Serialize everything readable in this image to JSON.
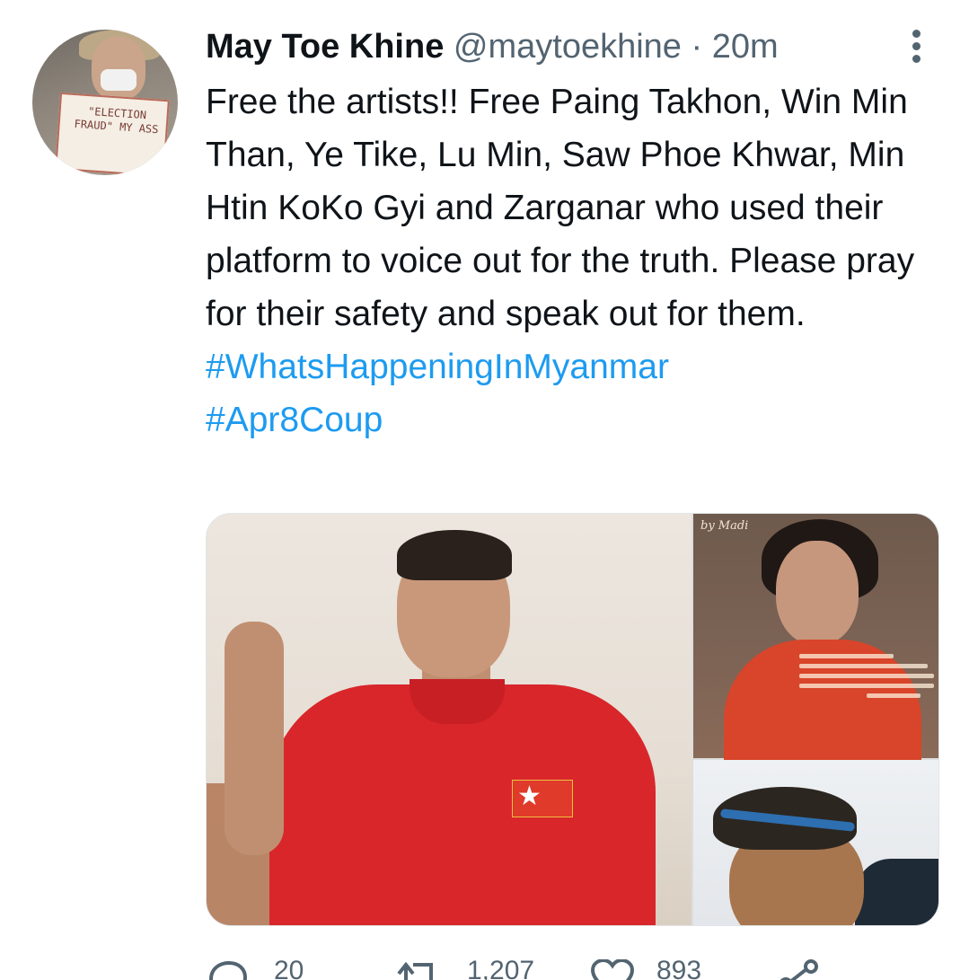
{
  "tweet": {
    "author_name": "May Toe Khine",
    "author_handle": "@maytoekhine",
    "separator": "·",
    "time": "20m",
    "text": "Free the artists!! Free Paing Takhon, Win Min Than, Ye Tike, Lu Min, Saw Phoe Khwar, Min Htin KoKo Gyi and Zarganar who used their platform to voice out for the truth. Please pray for their safety and speak out for them.",
    "hashtags": [
      "#WhatsHappeningInMyanmar",
      "#Apr8Coup"
    ]
  },
  "avatar": {
    "sign_text": "\"ELECTION FRAUD\" MY ASS"
  },
  "media": {
    "top_right_watermark": "by Madi"
  },
  "actions": {
    "reply_count": "20",
    "retweet_count": "1,207",
    "like_count": "893"
  },
  "colors": {
    "link": "#1d9bf0",
    "secondary_text": "#536471",
    "primary_text": "#0f1419"
  },
  "icons": [
    "more-vertical-icon",
    "reply-icon",
    "retweet-icon",
    "like-icon",
    "share-icon"
  ]
}
